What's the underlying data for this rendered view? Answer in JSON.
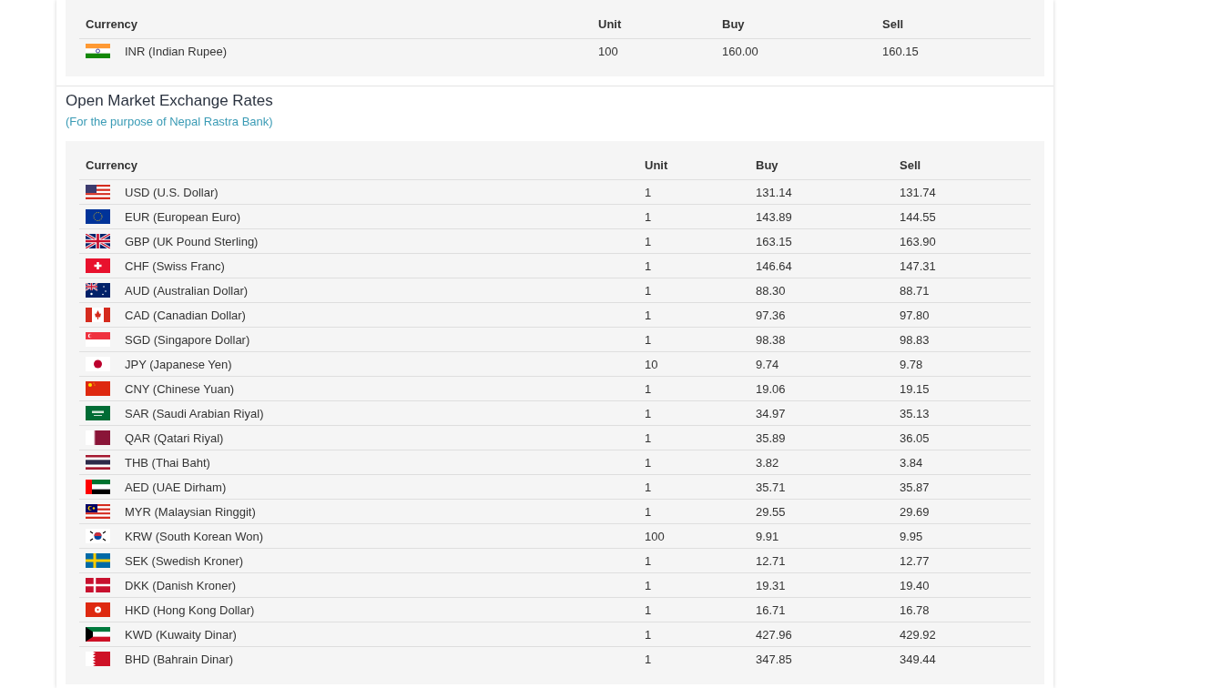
{
  "indian_rates": {
    "columns": [
      "Currency",
      "Unit",
      "Buy",
      "Sell"
    ],
    "rows": [
      {
        "currency": "INR (Indian Rupee)",
        "unit": "100",
        "buy": "160.00",
        "sell": "160.15"
      }
    ]
  },
  "open_market": {
    "title": "Open Market Exchange Rates",
    "subtitle": "(For the purpose of Nepal Rastra Bank)",
    "table": {
      "columns": [
        "Currency",
        "Unit",
        "Buy",
        "Sell"
      ],
      "rows": [
        {
          "currency": "USD (U.S. Dollar)",
          "unit": "1",
          "buy": "131.14",
          "sell": "131.74"
        },
        {
          "currency": "EUR (European Euro)",
          "unit": "1",
          "buy": "143.89",
          "sell": "144.55"
        },
        {
          "currency": "GBP (UK Pound Sterling)",
          "unit": "1",
          "buy": "163.15",
          "sell": "163.90"
        },
        {
          "currency": "CHF (Swiss Franc)",
          "unit": "1",
          "buy": "146.64",
          "sell": "147.31"
        },
        {
          "currency": "AUD (Australian Dollar)",
          "unit": "1",
          "buy": "88.30",
          "sell": "88.71"
        },
        {
          "currency": "CAD (Canadian Dollar)",
          "unit": "1",
          "buy": "97.36",
          "sell": "97.80"
        },
        {
          "currency": "SGD (Singapore Dollar)",
          "unit": "1",
          "buy": "98.38",
          "sell": "98.83"
        },
        {
          "currency": "JPY (Japanese Yen)",
          "unit": "10",
          "buy": "9.74",
          "sell": "9.78"
        },
        {
          "currency": "CNY (Chinese Yuan)",
          "unit": "1",
          "buy": "19.06",
          "sell": "19.15"
        },
        {
          "currency": "SAR (Saudi Arabian Riyal)",
          "unit": "1",
          "buy": "34.97",
          "sell": "35.13"
        },
        {
          "currency": "QAR (Qatari Riyal)",
          "unit": "1",
          "buy": "35.89",
          "sell": "36.05"
        },
        {
          "currency": "THB (Thai Baht)",
          "unit": "1",
          "buy": "3.82",
          "sell": "3.84"
        },
        {
          "currency": "AED (UAE Dirham)",
          "unit": "1",
          "buy": "35.71",
          "sell": "35.87"
        },
        {
          "currency": "MYR (Malaysian Ringgit)",
          "unit": "1",
          "buy": "29.55",
          "sell": "29.69"
        },
        {
          "currency": "KRW (South Korean Won)",
          "unit": "100",
          "buy": "9.91",
          "sell": "9.95"
        },
        {
          "currency": "SEK (Swedish Kroner)",
          "unit": "1",
          "buy": "12.71",
          "sell": "12.77"
        },
        {
          "currency": "DKK (Danish Kroner)",
          "unit": "1",
          "buy": "19.31",
          "sell": "19.40"
        },
        {
          "currency": "HKD (Hong Kong Dollar)",
          "unit": "1",
          "buy": "16.71",
          "sell": "16.78"
        },
        {
          "currency": "KWD (Kuwaity Dinar)",
          "unit": "1",
          "buy": "427.96",
          "sell": "429.92"
        },
        {
          "currency": "BHD (Bahrain Dinar)",
          "unit": "1",
          "buy": "347.85",
          "sell": "349.44"
        }
      ]
    }
  }
}
